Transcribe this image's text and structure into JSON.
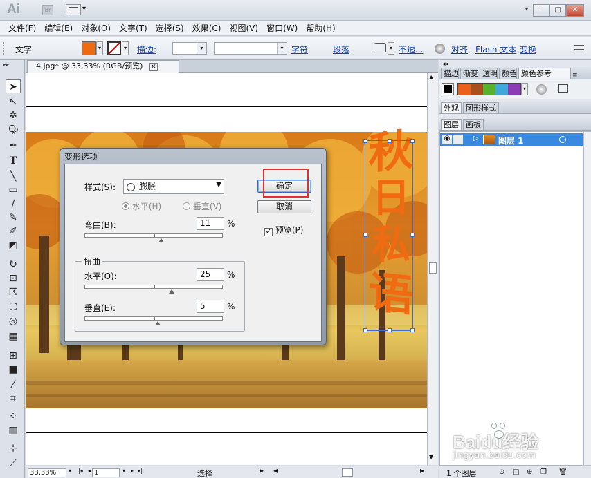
{
  "app": {
    "logo": "Ai",
    "br": "Br",
    "win_controls": [
      "▾",
      "–",
      "□",
      "✕"
    ]
  },
  "menu": [
    "文件(F)",
    "编辑(E)",
    "对象(O)",
    "文字(T)",
    "选择(S)",
    "效果(C)",
    "视图(V)",
    "窗口(W)",
    "帮助(H)"
  ],
  "control": {
    "label": "文字",
    "fill_color": "#f06a10",
    "stroke_label": "描边:",
    "char_link": "字符",
    "para_link": "段落",
    "opacity_link": "不透...",
    "align_link": "对齐",
    "flash_link": "Flash 文本",
    "transform_link": "变换"
  },
  "document": {
    "tab_label": "4.jpg* @ 33.33% (RGB/预览)",
    "close": "✕"
  },
  "artwork": {
    "vertical_text": [
      "秋",
      "日",
      "私",
      "语"
    ],
    "text_color": "#f06a12"
  },
  "status": {
    "zoom": "33.33%",
    "page": "1",
    "tool": "选择"
  },
  "panels": {
    "top_tabs": [
      "描边",
      "渐变",
      "透明",
      "颜色",
      "颜色参考"
    ],
    "swatches": [
      "#e8601a",
      "#a8501e",
      "#58b12e",
      "#3fa8d8",
      "#8c3cb4"
    ],
    "mid_tabs": [
      "外观",
      "图形样式"
    ],
    "layer_tabs": [
      "图层",
      "画板"
    ],
    "layer_name": "图层 1",
    "layer_count": "1 个图层"
  },
  "dialog": {
    "title": "变形选项",
    "style_label": "样式(S):",
    "style_value": "膨胀",
    "radio_horizontal": "水平(H)",
    "radio_vertical": "垂直(V)",
    "bend_label": "弯曲(B):",
    "bend_value": "11",
    "pct": "%",
    "distort_group": "扭曲",
    "horizontal_label": "水平(O):",
    "horizontal_value": "25",
    "vertical_label": "垂直(E):",
    "vertical_value": "5",
    "ok": "确定",
    "cancel": "取消",
    "preview": "预览(P)"
  },
  "watermark": {
    "brand": "Baidu经验",
    "url": "jingyan.baidu.com"
  }
}
